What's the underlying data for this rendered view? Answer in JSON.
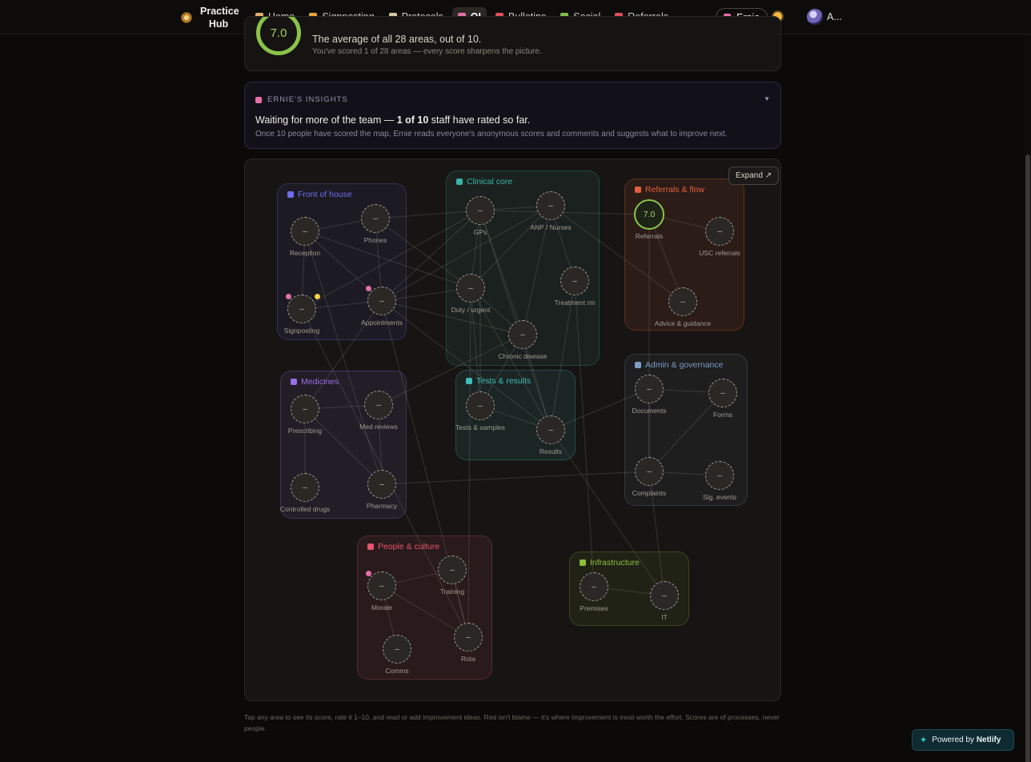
{
  "nav": {
    "brand": "Practice Hub",
    "items": [
      {
        "label": "Home",
        "icon": "house-icon",
        "color": "#e0b06a"
      },
      {
        "label": "Signposting",
        "icon": "signpost-icon",
        "color": "#e8a23c"
      },
      {
        "label": "Protocols",
        "icon": "clipboard-icon",
        "color": "#d9c7a3"
      },
      {
        "label": "QI",
        "icon": "target-icon",
        "color": "#e46fa7",
        "active": true
      },
      {
        "label": "Bulletins",
        "icon": "pin-icon",
        "color": "#e0505a"
      },
      {
        "label": "Social",
        "icon": "plant-icon",
        "color": "#7fbf4a"
      },
      {
        "label": "Referrals",
        "icon": "bookmark-icon",
        "color": "#e0505a"
      }
    ],
    "more": "···",
    "ernie": "Ernie",
    "user": "A..."
  },
  "score": {
    "value": "7.0",
    "line": "The average of all 28 areas, out of 10.",
    "sub": "You've scored 1 of 28 areas — every score sharpens the picture."
  },
  "insights": {
    "heading": "ERNIE'S INSIGHTS",
    "main_prefix": "Waiting for more of the team — ",
    "main_bold": "1 of 10",
    "main_suffix": " staff have rated so far.",
    "sub": "Once 10 people have scored the map, Ernie reads everyone's anonymous scores and comments and suggests what to improve next."
  },
  "map": {
    "expand": "Expand ↗",
    "clusters": [
      {
        "id": "front",
        "label": "Front of house",
        "color": "#6f6df0",
        "icon": "door-icon"
      },
      {
        "id": "clinical",
        "label": "Clinical core",
        "color": "#3ab3a6",
        "icon": "stethoscope-icon"
      },
      {
        "id": "referrals",
        "label": "Referrals & flow",
        "color": "#e2603d",
        "icon": "bookmark-icon"
      },
      {
        "id": "medicines",
        "label": "Medicines",
        "color": "#9b6ee6",
        "icon": "pill-icon"
      },
      {
        "id": "tests",
        "label": "Tests & results",
        "color": "#3fbcb8",
        "icon": "test-tube-icon"
      },
      {
        "id": "admin",
        "label": "Admin & governance",
        "color": "#7d9cc6",
        "icon": "folder-icon"
      },
      {
        "id": "people",
        "label": "People & culture",
        "color": "#e8536e",
        "icon": "people-icon"
      },
      {
        "id": "infra",
        "label": "Infrastructure",
        "color": "#8fbf3c",
        "icon": "building-icon"
      }
    ],
    "nodes": [
      {
        "id": "reception",
        "label": "Reception",
        "score": "–"
      },
      {
        "id": "phones",
        "label": "Phones",
        "score": "–"
      },
      {
        "id": "signposting",
        "label": "Signposting",
        "score": "–"
      },
      {
        "id": "appointments",
        "label": "Appointments",
        "score": "–"
      },
      {
        "id": "gps",
        "label": "GPs",
        "score": "–"
      },
      {
        "id": "anp",
        "label": "ANP / Nurses",
        "score": "–"
      },
      {
        "id": "duty",
        "label": "Duty / urgent",
        "score": "–"
      },
      {
        "id": "treatment",
        "label": "Treatment rm",
        "score": "–"
      },
      {
        "id": "chronic",
        "label": "Chronic disease",
        "score": "–"
      },
      {
        "id": "referrals",
        "label": "Referrals",
        "score": "7.0"
      },
      {
        "id": "usc",
        "label": "USC referrals",
        "score": "–"
      },
      {
        "id": "advice",
        "label": "Advice & guidance",
        "score": "–"
      },
      {
        "id": "prescribing",
        "label": "Prescribing",
        "score": "–"
      },
      {
        "id": "medreviews",
        "label": "Med reviews",
        "score": "–"
      },
      {
        "id": "controlled",
        "label": "Controlled drugs",
        "score": "–"
      },
      {
        "id": "pharmacy",
        "label": "Pharmacy",
        "score": "–"
      },
      {
        "id": "tests",
        "label": "Tests & samples",
        "score": "–"
      },
      {
        "id": "results",
        "label": "Results",
        "score": "–"
      },
      {
        "id": "documents",
        "label": "Documents",
        "score": "–"
      },
      {
        "id": "forms",
        "label": "Forms",
        "score": "–"
      },
      {
        "id": "complaints",
        "label": "Complaints",
        "score": "–"
      },
      {
        "id": "sigevents",
        "label": "Sig. events",
        "score": "–"
      },
      {
        "id": "morale",
        "label": "Morale",
        "score": "–"
      },
      {
        "id": "training",
        "label": "Training",
        "score": "–"
      },
      {
        "id": "comms",
        "label": "Comms",
        "score": "–"
      },
      {
        "id": "rota",
        "label": "Rota",
        "score": "–"
      },
      {
        "id": "premises",
        "label": "Premises",
        "score": "–"
      },
      {
        "id": "it",
        "label": "IT",
        "score": "–"
      }
    ]
  },
  "footer": {
    "note": "Tap any area to see its score, rate it 1–10, and read or add improvement ideas. Red isn't blame — it's where improvement is most worth the effort. Scores are of processes, never people.",
    "netlify_prefix": "Powered by ",
    "netlify_bold": "Netlify"
  }
}
